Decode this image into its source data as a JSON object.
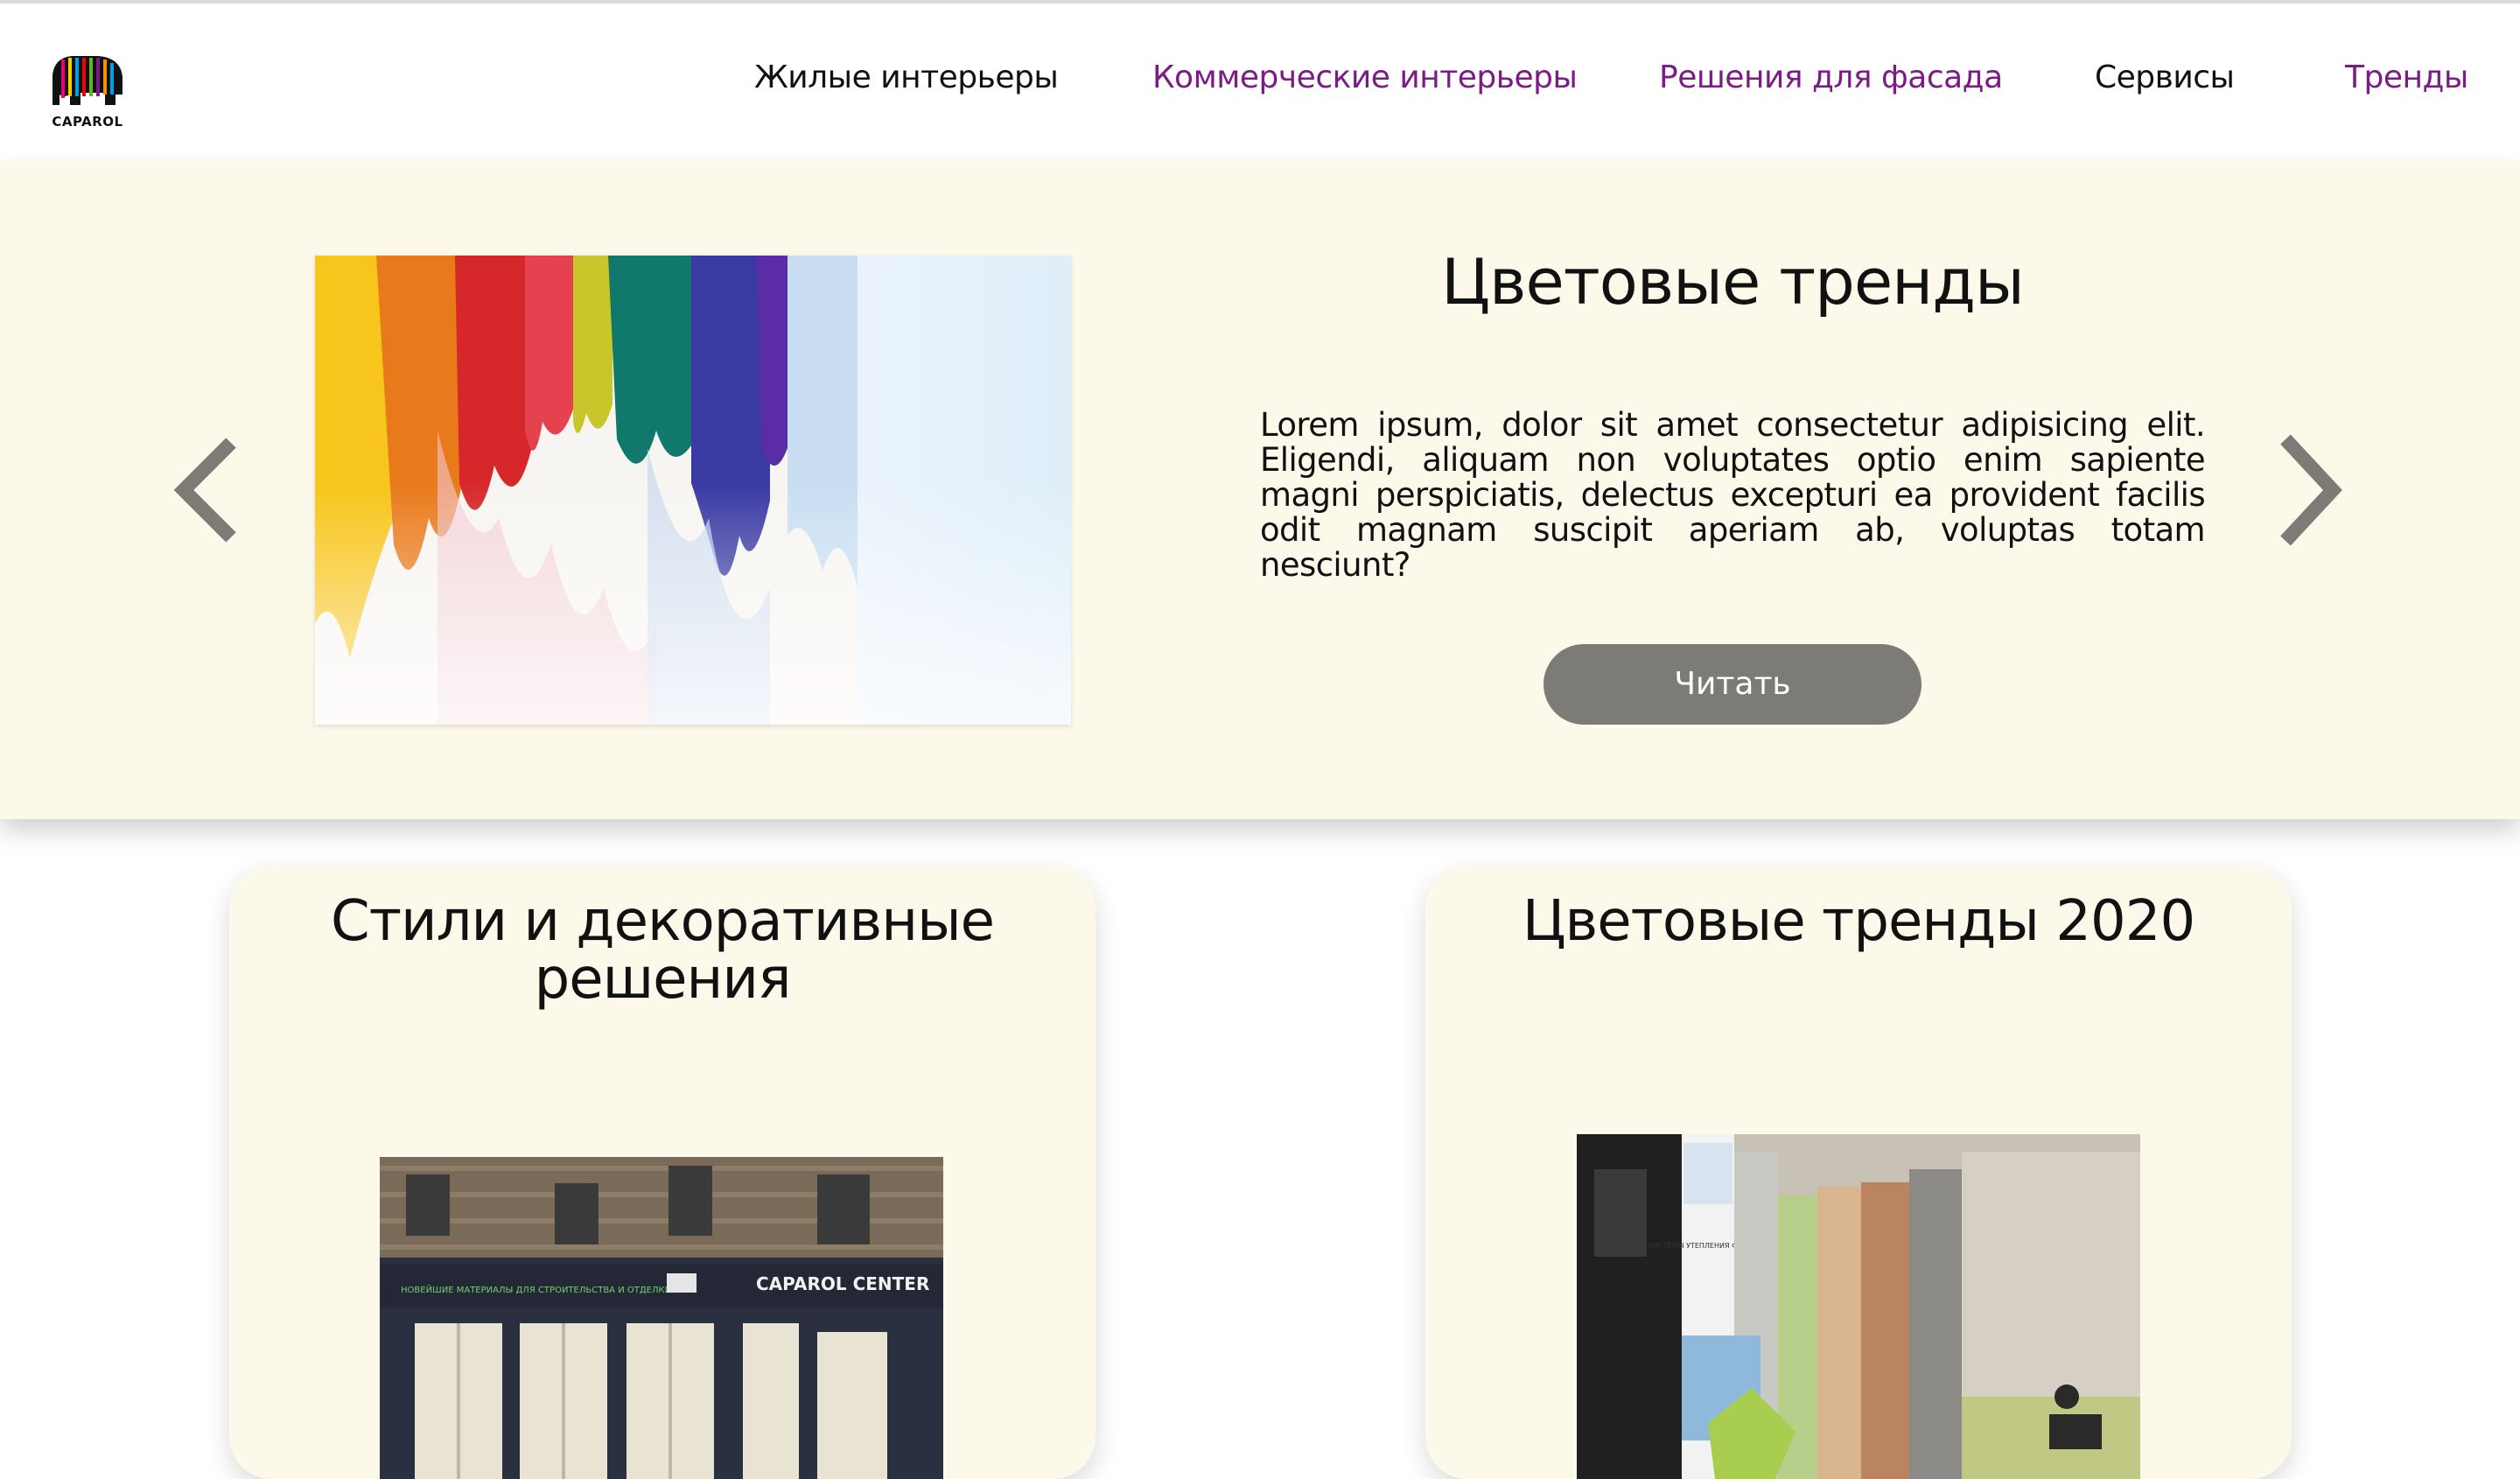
{
  "logo": {
    "text": "CAPAROL"
  },
  "nav": {
    "items": [
      {
        "label": "Жилые интерьеры",
        "color": "#111111"
      },
      {
        "label": "Коммерческие интерьеры",
        "color": "#7b1c86"
      },
      {
        "label": "Решения для фасада",
        "color": "#7b1c86"
      },
      {
        "label": "Сервисы",
        "color": "#111111"
      },
      {
        "label": "Тренды",
        "color": "#7b1c86"
      }
    ]
  },
  "hero": {
    "title": "Цветовые тренды",
    "text": "Lorem ipsum, dolor sit amet consectetur adipisicing elit. Eligendi, aliquam non voluptates optio enim sapiente magni perspiciatis, delectus excepturi ea provident facilis odit magnam suscipit aperiam ab, voluptas totam nesciunt?",
    "button_label": "Читать",
    "background": "#fcf9ea",
    "button_color": "#7d7b76"
  },
  "cards": [
    {
      "title": "Стили и декоративные решения",
      "image_sign": "CAPAROL CENTER",
      "image_banner": "НОВЕЙШИЕ МАТЕРИАЛЫ ДЛЯ СТРОИТЕЛЬСТВА И ОТДЕЛКИ"
    },
    {
      "title": "Цветовые тренды 2020",
      "image_sign": "СИСТЕМЫ УТЕПЛЕНИЯ ФАСАДОВ"
    }
  ],
  "icons": {
    "prev": "chevron-left-icon",
    "next": "chevron-right-icon"
  }
}
